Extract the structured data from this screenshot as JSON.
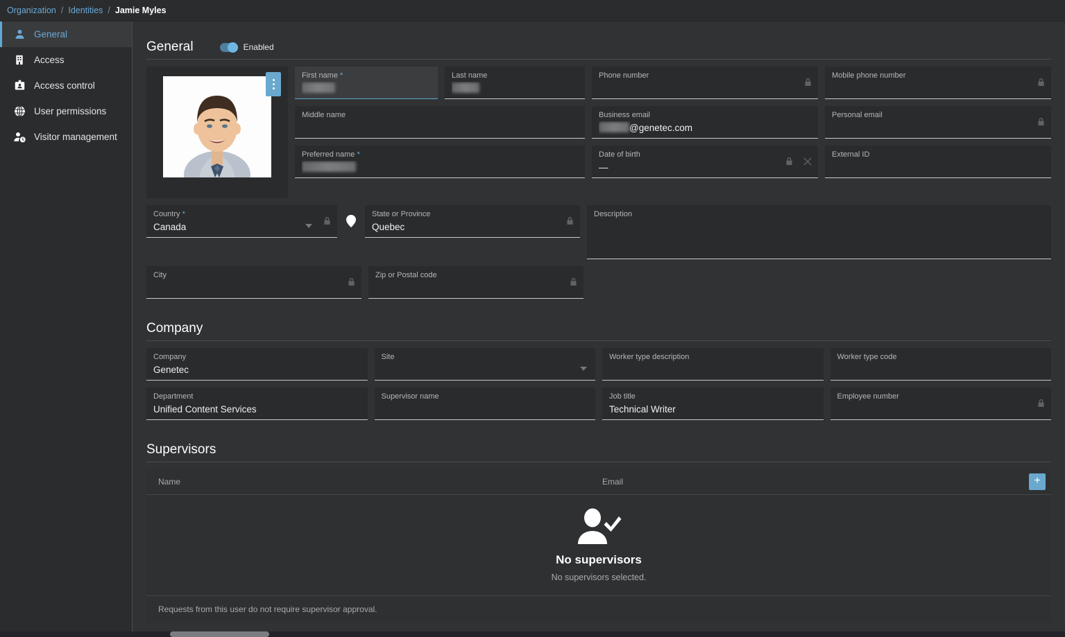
{
  "breadcrumb": {
    "items": [
      {
        "label": "Organization",
        "type": "link"
      },
      {
        "label": "Identities",
        "type": "link"
      },
      {
        "label": "Jamie Myles",
        "type": "current"
      }
    ],
    "separator": "/"
  },
  "sidebar": {
    "items": [
      {
        "label": "General",
        "icon": "person-icon",
        "active": true
      },
      {
        "label": "Access",
        "icon": "building-icon",
        "active": false
      },
      {
        "label": "Access control",
        "icon": "badge-icon",
        "active": false
      },
      {
        "label": "User permissions",
        "icon": "globe-icon",
        "active": false
      },
      {
        "label": "Visitor management",
        "icon": "person-clock-icon",
        "active": false
      }
    ]
  },
  "general": {
    "title": "General",
    "toggle_label": "Enabled",
    "toggle_on": true,
    "photo_menu_icon": "kebab-menu-icon",
    "fields": {
      "first_name": {
        "label": "First name",
        "required": true,
        "value": "",
        "redacted": true,
        "focused": true
      },
      "last_name": {
        "label": "Last name",
        "required": false,
        "value": "",
        "redacted": true
      },
      "phone_number": {
        "label": "Phone number",
        "value": "",
        "locked": true
      },
      "mobile_phone_number": {
        "label": "Mobile phone number",
        "value": "",
        "locked": true
      },
      "middle_name": {
        "label": "Middle name",
        "value": ""
      },
      "business_email": {
        "label": "Business email",
        "value": "@genetec.com",
        "redacted_prefix": true
      },
      "personal_email": {
        "label": "Personal email",
        "value": "",
        "locked": true
      },
      "preferred_name": {
        "label": "Preferred name",
        "required": true,
        "value": "",
        "redacted": true
      },
      "date_of_birth": {
        "label": "Date of birth",
        "value": "—",
        "locked": true,
        "clearable": true
      },
      "external_id": {
        "label": "External ID",
        "value": ""
      },
      "country": {
        "label": "Country",
        "required": true,
        "value": "Canada",
        "locked": true,
        "dropdown": true
      },
      "state_or_province": {
        "label": "State or Province",
        "value": "Quebec",
        "locked": true
      },
      "description": {
        "label": "Description",
        "value": ""
      },
      "city": {
        "label": "City",
        "value": "",
        "locked": true
      },
      "zip_or_postal_code": {
        "label": "Zip or Postal code",
        "value": "",
        "locked": true
      }
    }
  },
  "company": {
    "title": "Company",
    "fields": {
      "company": {
        "label": "Company",
        "value": "Genetec"
      },
      "site": {
        "label": "Site",
        "value": "",
        "dropdown": true
      },
      "worker_type_description": {
        "label": "Worker type description",
        "value": ""
      },
      "worker_type_code": {
        "label": "Worker type code",
        "value": ""
      },
      "department": {
        "label": "Department",
        "value": "Unified Content Services"
      },
      "supervisor_name": {
        "label": "Supervisor name",
        "value": ""
      },
      "job_title": {
        "label": "Job title",
        "value": "Technical Writer"
      },
      "employee_number": {
        "label": "Employee number",
        "value": "",
        "locked": true
      }
    }
  },
  "supervisors": {
    "title": "Supervisors",
    "columns": [
      "Name",
      "Email"
    ],
    "add_button_label": "+",
    "empty_icon": "user-check-icon",
    "empty_title": "No supervisors",
    "empty_subtitle": "No supervisors selected.",
    "footer_note": "Requests from this user do not require supervisor approval."
  },
  "colors": {
    "accent": "#6aa9d6",
    "page_background": "#313234",
    "field_background": "#2a2b2c",
    "sidebar_background": "#2b2c2e",
    "button_blue": "#6aa9cd"
  }
}
